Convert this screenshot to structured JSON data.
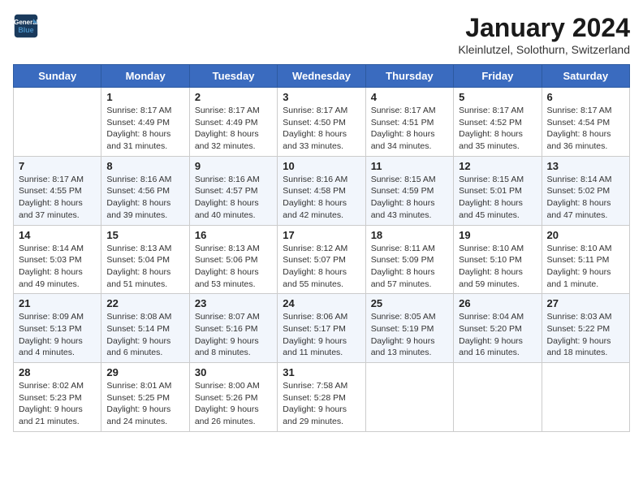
{
  "header": {
    "logo_line1": "General",
    "logo_line2": "Blue",
    "title": "January 2024",
    "subtitle": "Kleinlutzel, Solothurn, Switzerland"
  },
  "days": [
    "Sunday",
    "Monday",
    "Tuesday",
    "Wednesday",
    "Thursday",
    "Friday",
    "Saturday"
  ],
  "weeks": [
    [
      {
        "date": "",
        "sunrise": "",
        "sunset": "",
        "daylight": ""
      },
      {
        "date": "1",
        "sunrise": "Sunrise: 8:17 AM",
        "sunset": "Sunset: 4:49 PM",
        "daylight": "Daylight: 8 hours and 31 minutes."
      },
      {
        "date": "2",
        "sunrise": "Sunrise: 8:17 AM",
        "sunset": "Sunset: 4:49 PM",
        "daylight": "Daylight: 8 hours and 32 minutes."
      },
      {
        "date": "3",
        "sunrise": "Sunrise: 8:17 AM",
        "sunset": "Sunset: 4:50 PM",
        "daylight": "Daylight: 8 hours and 33 minutes."
      },
      {
        "date": "4",
        "sunrise": "Sunrise: 8:17 AM",
        "sunset": "Sunset: 4:51 PM",
        "daylight": "Daylight: 8 hours and 34 minutes."
      },
      {
        "date": "5",
        "sunrise": "Sunrise: 8:17 AM",
        "sunset": "Sunset: 4:52 PM",
        "daylight": "Daylight: 8 hours and 35 minutes."
      },
      {
        "date": "6",
        "sunrise": "Sunrise: 8:17 AM",
        "sunset": "Sunset: 4:54 PM",
        "daylight": "Daylight: 8 hours and 36 minutes."
      }
    ],
    [
      {
        "date": "7",
        "sunrise": "Sunrise: 8:17 AM",
        "sunset": "Sunset: 4:55 PM",
        "daylight": "Daylight: 8 hours and 37 minutes."
      },
      {
        "date": "8",
        "sunrise": "Sunrise: 8:16 AM",
        "sunset": "Sunset: 4:56 PM",
        "daylight": "Daylight: 8 hours and 39 minutes."
      },
      {
        "date": "9",
        "sunrise": "Sunrise: 8:16 AM",
        "sunset": "Sunset: 4:57 PM",
        "daylight": "Daylight: 8 hours and 40 minutes."
      },
      {
        "date": "10",
        "sunrise": "Sunrise: 8:16 AM",
        "sunset": "Sunset: 4:58 PM",
        "daylight": "Daylight: 8 hours and 42 minutes."
      },
      {
        "date": "11",
        "sunrise": "Sunrise: 8:15 AM",
        "sunset": "Sunset: 4:59 PM",
        "daylight": "Daylight: 8 hours and 43 minutes."
      },
      {
        "date": "12",
        "sunrise": "Sunrise: 8:15 AM",
        "sunset": "Sunset: 5:01 PM",
        "daylight": "Daylight: 8 hours and 45 minutes."
      },
      {
        "date": "13",
        "sunrise": "Sunrise: 8:14 AM",
        "sunset": "Sunset: 5:02 PM",
        "daylight": "Daylight: 8 hours and 47 minutes."
      }
    ],
    [
      {
        "date": "14",
        "sunrise": "Sunrise: 8:14 AM",
        "sunset": "Sunset: 5:03 PM",
        "daylight": "Daylight: 8 hours and 49 minutes."
      },
      {
        "date": "15",
        "sunrise": "Sunrise: 8:13 AM",
        "sunset": "Sunset: 5:04 PM",
        "daylight": "Daylight: 8 hours and 51 minutes."
      },
      {
        "date": "16",
        "sunrise": "Sunrise: 8:13 AM",
        "sunset": "Sunset: 5:06 PM",
        "daylight": "Daylight: 8 hours and 53 minutes."
      },
      {
        "date": "17",
        "sunrise": "Sunrise: 8:12 AM",
        "sunset": "Sunset: 5:07 PM",
        "daylight": "Daylight: 8 hours and 55 minutes."
      },
      {
        "date": "18",
        "sunrise": "Sunrise: 8:11 AM",
        "sunset": "Sunset: 5:09 PM",
        "daylight": "Daylight: 8 hours and 57 minutes."
      },
      {
        "date": "19",
        "sunrise": "Sunrise: 8:10 AM",
        "sunset": "Sunset: 5:10 PM",
        "daylight": "Daylight: 8 hours and 59 minutes."
      },
      {
        "date": "20",
        "sunrise": "Sunrise: 8:10 AM",
        "sunset": "Sunset: 5:11 PM",
        "daylight": "Daylight: 9 hours and 1 minute."
      }
    ],
    [
      {
        "date": "21",
        "sunrise": "Sunrise: 8:09 AM",
        "sunset": "Sunset: 5:13 PM",
        "daylight": "Daylight: 9 hours and 4 minutes."
      },
      {
        "date": "22",
        "sunrise": "Sunrise: 8:08 AM",
        "sunset": "Sunset: 5:14 PM",
        "daylight": "Daylight: 9 hours and 6 minutes."
      },
      {
        "date": "23",
        "sunrise": "Sunrise: 8:07 AM",
        "sunset": "Sunset: 5:16 PM",
        "daylight": "Daylight: 9 hours and 8 minutes."
      },
      {
        "date": "24",
        "sunrise": "Sunrise: 8:06 AM",
        "sunset": "Sunset: 5:17 PM",
        "daylight": "Daylight: 9 hours and 11 minutes."
      },
      {
        "date": "25",
        "sunrise": "Sunrise: 8:05 AM",
        "sunset": "Sunset: 5:19 PM",
        "daylight": "Daylight: 9 hours and 13 minutes."
      },
      {
        "date": "26",
        "sunrise": "Sunrise: 8:04 AM",
        "sunset": "Sunset: 5:20 PM",
        "daylight": "Daylight: 9 hours and 16 minutes."
      },
      {
        "date": "27",
        "sunrise": "Sunrise: 8:03 AM",
        "sunset": "Sunset: 5:22 PM",
        "daylight": "Daylight: 9 hours and 18 minutes."
      }
    ],
    [
      {
        "date": "28",
        "sunrise": "Sunrise: 8:02 AM",
        "sunset": "Sunset: 5:23 PM",
        "daylight": "Daylight: 9 hours and 21 minutes."
      },
      {
        "date": "29",
        "sunrise": "Sunrise: 8:01 AM",
        "sunset": "Sunset: 5:25 PM",
        "daylight": "Daylight: 9 hours and 24 minutes."
      },
      {
        "date": "30",
        "sunrise": "Sunrise: 8:00 AM",
        "sunset": "Sunset: 5:26 PM",
        "daylight": "Daylight: 9 hours and 26 minutes."
      },
      {
        "date": "31",
        "sunrise": "Sunrise: 7:58 AM",
        "sunset": "Sunset: 5:28 PM",
        "daylight": "Daylight: 9 hours and 29 minutes."
      },
      {
        "date": "",
        "sunrise": "",
        "sunset": "",
        "daylight": ""
      },
      {
        "date": "",
        "sunrise": "",
        "sunset": "",
        "daylight": ""
      },
      {
        "date": "",
        "sunrise": "",
        "sunset": "",
        "daylight": ""
      }
    ]
  ]
}
